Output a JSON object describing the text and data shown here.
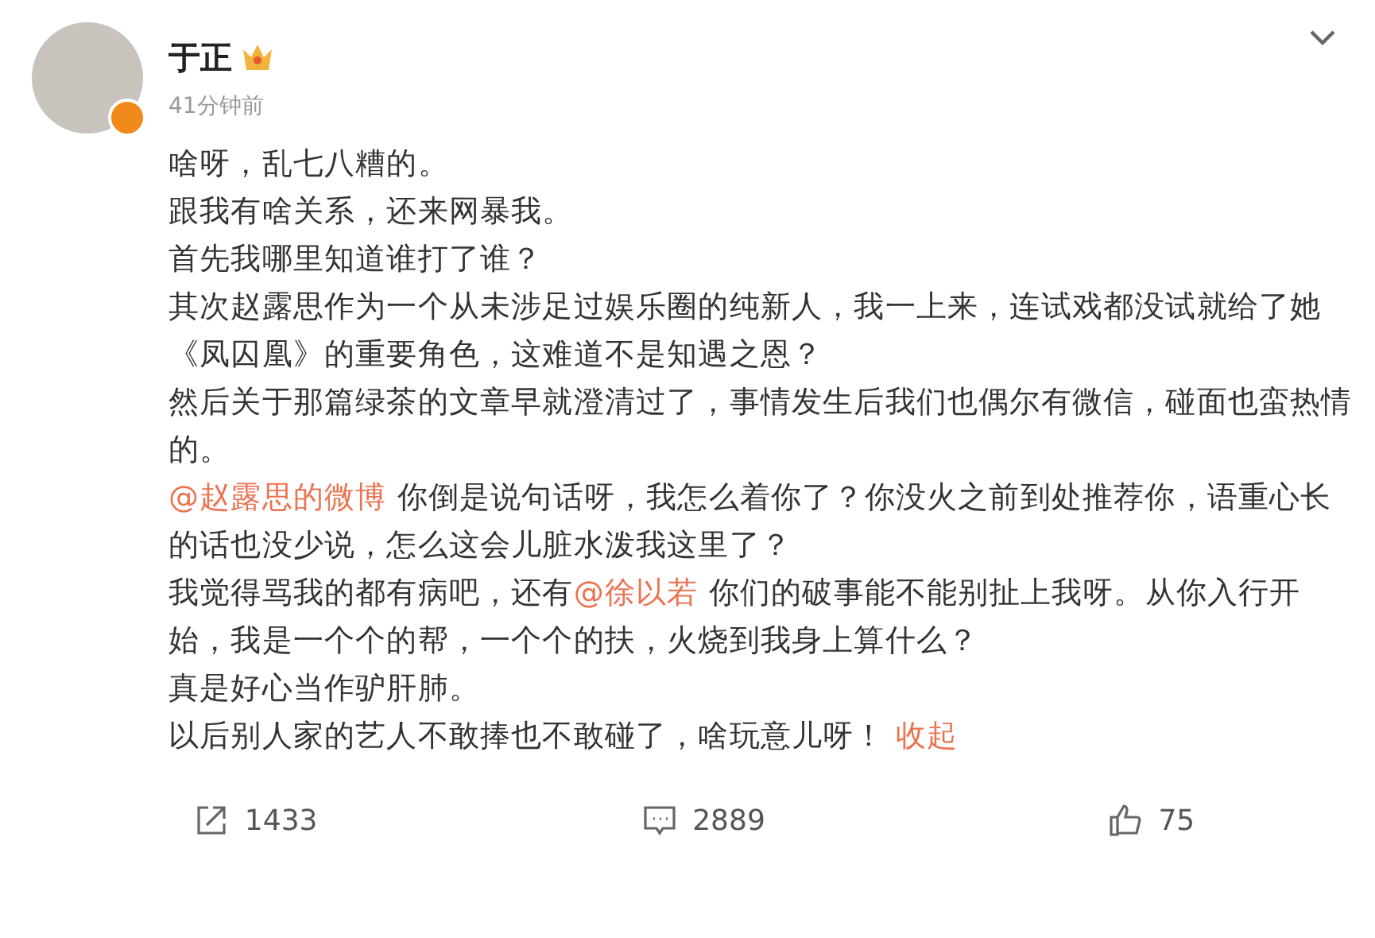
{
  "author": {
    "name": "于正",
    "time": "41分钟前"
  },
  "paragraphs": [
    [
      {
        "kind": "text",
        "text": "啥呀，乱七八糟的。"
      }
    ],
    [
      {
        "kind": "text",
        "text": "跟我有啥关系，还来网暴我。"
      }
    ],
    [
      {
        "kind": "text",
        "text": "首先我哪里知道谁打了谁？"
      }
    ],
    [
      {
        "kind": "text",
        "text": "其次赵露思作为一个从未涉足过娱乐圈的纯新人，我一上来，连试戏都没试就给了她《凤囚凰》的重要角色，这难道不是知遇之恩？"
      }
    ],
    [
      {
        "kind": "text",
        "text": "然后关于那篇绿茶的文章早就澄清过了，事情发生后我们也偶尔有微信，碰面也蛮热情的。"
      }
    ],
    [
      {
        "kind": "mention",
        "text": "@赵露思的微博"
      },
      {
        "kind": "text",
        "text": " 你倒是说句话呀，我怎么着你了？你没火之前到处推荐你，语重心长的话也没少说，怎么这会儿脏水泼我这里了？"
      }
    ],
    [
      {
        "kind": "text",
        "text": "我觉得骂我的都有病吧，还有"
      },
      {
        "kind": "mention",
        "text": "@徐以若"
      },
      {
        "kind": "text",
        "text": " 你们的破事能不能别扯上我呀。从你入行开始，我是一个个的帮，一个个的扶，火烧到我身上算什么？"
      }
    ],
    [
      {
        "kind": "text",
        "text": "真是好心当作驴肝肺。"
      }
    ],
    [
      {
        "kind": "text",
        "text": "以后别人家的艺人不敢捧也不敢碰了，啥玩意儿呀！ "
      },
      {
        "kind": "link",
        "text": "收起"
      }
    ]
  ],
  "actions": [
    {
      "kind": "share",
      "count": "1433"
    },
    {
      "kind": "comment",
      "count": "2889"
    },
    {
      "kind": "like",
      "count": "75"
    }
  ]
}
